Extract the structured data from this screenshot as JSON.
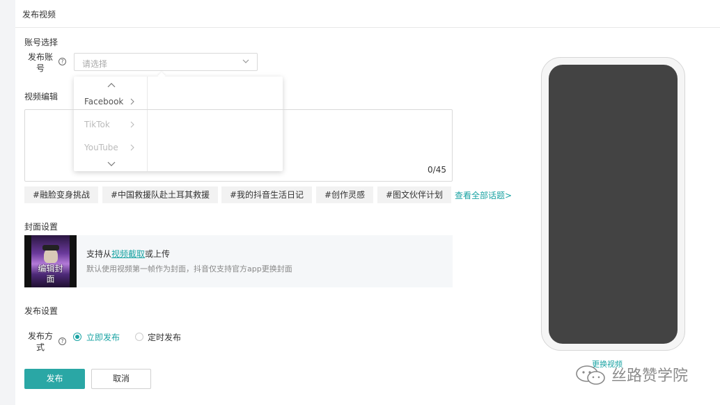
{
  "header": {
    "title": "发布视频"
  },
  "account": {
    "section_title": "账号选择",
    "field_label_l1": "发布账",
    "field_label_l2": "号",
    "select_placeholder": "请选择",
    "dropdown_items": [
      {
        "label": "Facebook",
        "state": "enabled"
      },
      {
        "label": "TikTok",
        "state": "disabled"
      },
      {
        "label": "YouTube",
        "state": "disabled"
      }
    ]
  },
  "video_edit": {
    "section_title": "视频编辑",
    "counter": "0/45",
    "tags": [
      "#融脸变身挑战",
      "#中国救援队赴土耳其救援",
      "#我的抖音生活日记",
      "#创作灵感",
      "#图文伙伴计划"
    ],
    "view_all": "查看全部话题>"
  },
  "cover": {
    "section_title": "封面设置",
    "edit_label_l1": "编辑封",
    "edit_label_l2": "面",
    "text_prefix": "支持从",
    "text_link": "视频截取",
    "text_suffix": "或上传",
    "hint": "默认使用视频第一帧作为封面，抖音仅支持官方app更换封面"
  },
  "publish": {
    "section_title": "发布设置",
    "method_label_l1": "发布方",
    "method_label_l2": "式",
    "options": [
      {
        "label": "立即发布",
        "selected": true
      },
      {
        "label": "定时发布",
        "selected": false
      }
    ]
  },
  "actions": {
    "publish": "发布",
    "cancel": "取消"
  },
  "preview": {
    "change_video": "更换视频"
  },
  "watermark": {
    "text": "丝路赞学院"
  },
  "colors": {
    "accent": "#2aa7a5",
    "link": "#1aa3a3",
    "phone_screen": "#434343"
  }
}
